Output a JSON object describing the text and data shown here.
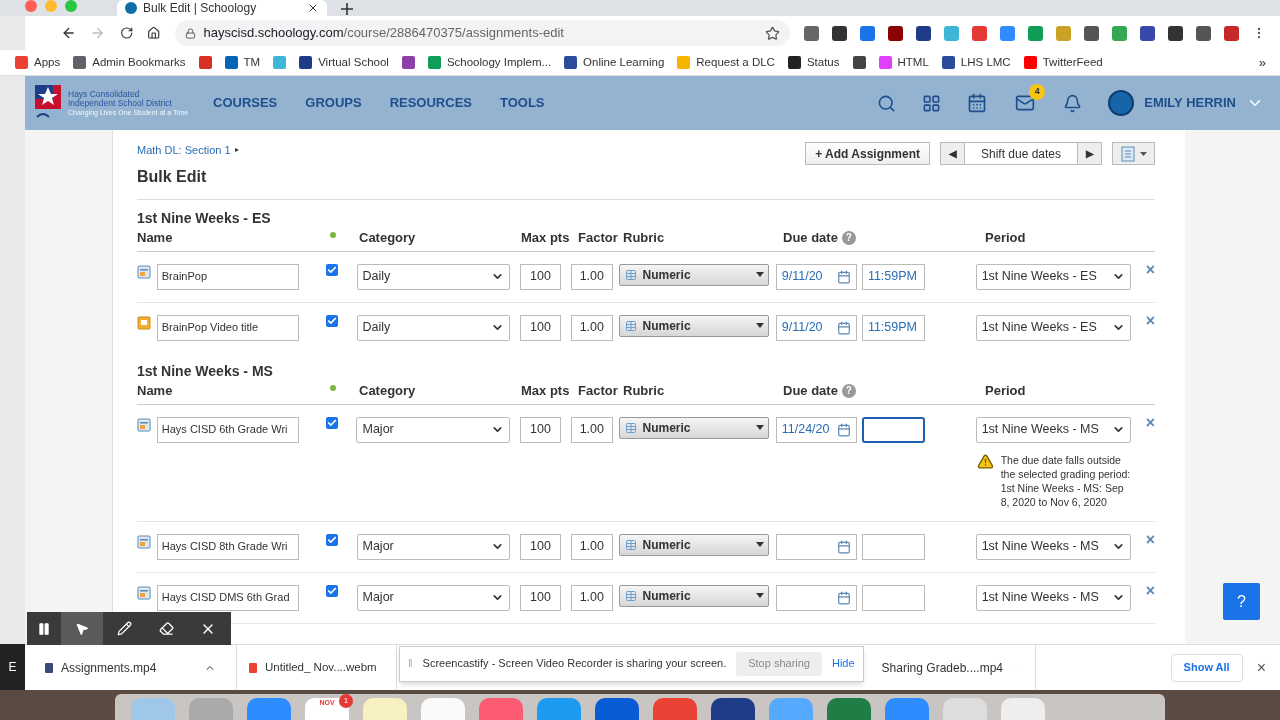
{
  "browser": {
    "tab_title": "Bulk Edit | Schoology",
    "url_host": "hayscisd.schoology.com",
    "url_path": "/course/2886470375/assignments-edit",
    "bookmarks": [
      {
        "label": "Apps",
        "color": "#e94235"
      },
      {
        "label": "Admin Bookmarks",
        "color": "#5f6368"
      },
      {
        "color": "#d93025"
      },
      {
        "label": "TM",
        "color": "#0364b8"
      },
      {
        "color": "#3fb6d8"
      },
      {
        "label": "Virtual School",
        "color": "#1f3c88"
      },
      {
        "color": "#8e3fa8"
      },
      {
        "label": "Schoology Implem...",
        "color": "#0f9d58"
      },
      {
        "label": "Online Learning",
        "color": "#2b4c9b"
      },
      {
        "label": "Request a DLC",
        "color": "#f4b400"
      },
      {
        "label": "Status",
        "color": "#222222"
      },
      {
        "color": "#444444"
      },
      {
        "label": "HTML",
        "color": "#e040fb"
      },
      {
        "label": "LHS LMC",
        "color": "#2b4c9b"
      },
      {
        "label": "TwitterFeed",
        "color": "#ff0000"
      }
    ],
    "more": "»"
  },
  "nav": {
    "links": [
      "COURSES",
      "GROUPS",
      "RESOURCES",
      "TOOLS"
    ],
    "mail_badge": "4",
    "user": "EMILY HERRIN",
    "logo_line_1": "Hays Consolidated",
    "logo_line_2": "Independent School District",
    "logo_tagline": "Changing Lives One Student at a Time"
  },
  "page": {
    "breadcrumb": "Math DL: Section 1",
    "breadcrumb_arrow": "▸",
    "title": "Bulk Edit",
    "add_button": "+ Add Assignment",
    "prev": "◀",
    "shift": "Shift due dates",
    "next": "▶"
  },
  "sections": [
    {
      "title": "1st Nine Weeks - ES",
      "columns": {
        "name": "Name",
        "category": "Category",
        "max_pts": "Max pts",
        "factor": "Factor",
        "rubric": "Rubric",
        "due_date": "Due date",
        "help": "?",
        "period": "Period"
      },
      "rows": [
        {
          "kind": "assignment",
          "name": "BrainPop",
          "published": true,
          "category": "Daily",
          "max_pts": "100",
          "factor": "1.00",
          "rubric": "Numeric",
          "date": "9/11/20",
          "time": "11:59PM",
          "time_focused": false,
          "period": "1st Nine Weeks - ES",
          "remove": "×"
        },
        {
          "kind": "media",
          "name": "BrainPop Video title",
          "published": true,
          "category": "Daily",
          "max_pts": "100",
          "factor": "1.00",
          "rubric": "Numeric",
          "date": "9/11/20",
          "time": "11:59PM",
          "time_focused": false,
          "period": "1st Nine Weeks - ES",
          "remove": "×"
        }
      ]
    },
    {
      "title": "1st Nine Weeks - MS",
      "columns": {
        "name": "Name",
        "category": "Category",
        "max_pts": "Max pts",
        "factor": "Factor",
        "rubric": "Rubric",
        "due_date": "Due date",
        "help": "?",
        "period": "Period"
      },
      "rows": [
        {
          "kind": "assignment",
          "name": "Hays CISD 6th Grade Wri",
          "published": true,
          "category": "Major",
          "max_pts": "100",
          "factor": "1.00",
          "rubric": "Numeric",
          "date": "11/24/20",
          "time": "",
          "time_focused": true,
          "period": "1st Nine Weeks - MS",
          "remove": "×",
          "warning": "The due date falls outside the selected grading period: 1st Nine Weeks - MS: Sep 8, 2020 to Nov 6, 2020"
        },
        {
          "kind": "assignment",
          "name": "Hays CISD 8th Grade Wri",
          "published": true,
          "category": "Major",
          "max_pts": "100",
          "factor": "1.00",
          "rubric": "Numeric",
          "date": "",
          "time": "",
          "time_focused": false,
          "period": "1st Nine Weeks - MS",
          "remove": "×"
        },
        {
          "kind": "assignment",
          "name": "Hays CISD DMS 6th Grad",
          "published": true,
          "category": "Major",
          "max_pts": "100",
          "factor": "1.00",
          "rubric": "Numeric",
          "date": "",
          "time": "",
          "time_focused": false,
          "period": "1st Nine Weeks - MS",
          "remove": "×"
        }
      ]
    }
  ],
  "help_button": "?",
  "downloads": {
    "edge_text": "E",
    "items": [
      {
        "name": "Assignments.mp4",
        "color": "#3c4a7a"
      },
      {
        "name": "Untitled_ Nov....webm",
        "color": "#e94235"
      }
    ],
    "sharing": {
      "grip": "‖",
      "message": "Screencastify - Screen Video Recorder is sharing your screen.",
      "stop": "Stop sharing",
      "hide": "Hide"
    },
    "after": [
      {
        "name": "Sharing Gradeb....mp4"
      }
    ],
    "show_all": "Show All",
    "close": "×"
  },
  "dock": {
    "calendar_month": "NOV",
    "calendar_badge": "1"
  }
}
